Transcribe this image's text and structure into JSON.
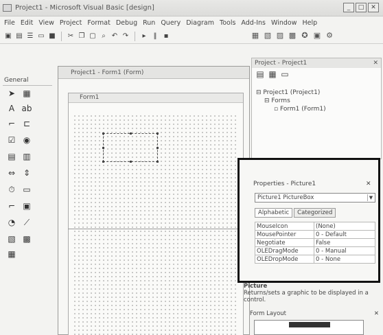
{
  "window": {
    "title": "Project1 - Microsoft Visual Basic [design]",
    "controls": [
      "_",
      "□",
      "✕"
    ]
  },
  "menu": [
    "File",
    "Edit",
    "View",
    "Project",
    "Format",
    "Debug",
    "Run",
    "Query",
    "Diagram",
    "Tools",
    "Add-Ins",
    "Window",
    "Help"
  ],
  "toolbox": {
    "title": "General"
  },
  "child_window": {
    "title": "Project1 - Form1 (Form)",
    "form_title": "Form1"
  },
  "project_explorer": {
    "title": "Project - Project1",
    "close": "✕",
    "tree": [
      "Project1 (Project1)",
      "Forms",
      "Form1 (Form1)"
    ]
  },
  "properties": {
    "title": "Properties - Picture1",
    "close": "✕",
    "object_combo": "Picture1 PictureBox",
    "tabs": [
      "Alphabetic",
      "Categorized"
    ],
    "rows": [
      {
        "name": "MouseIcon",
        "value": "(None)"
      },
      {
        "name": "MousePointer",
        "value": "0 - Default"
      },
      {
        "name": "Negotiate",
        "value": "False"
      },
      {
        "name": "OLEDragMode",
        "value": "0 - Manual"
      },
      {
        "name": "OLEDropMode",
        "value": "0 - None"
      }
    ]
  },
  "description": {
    "title": "Picture",
    "text": "Returns/sets a graphic to be displayed in a control."
  },
  "form_layout": {
    "title": "Form Layout",
    "close": "✕"
  }
}
